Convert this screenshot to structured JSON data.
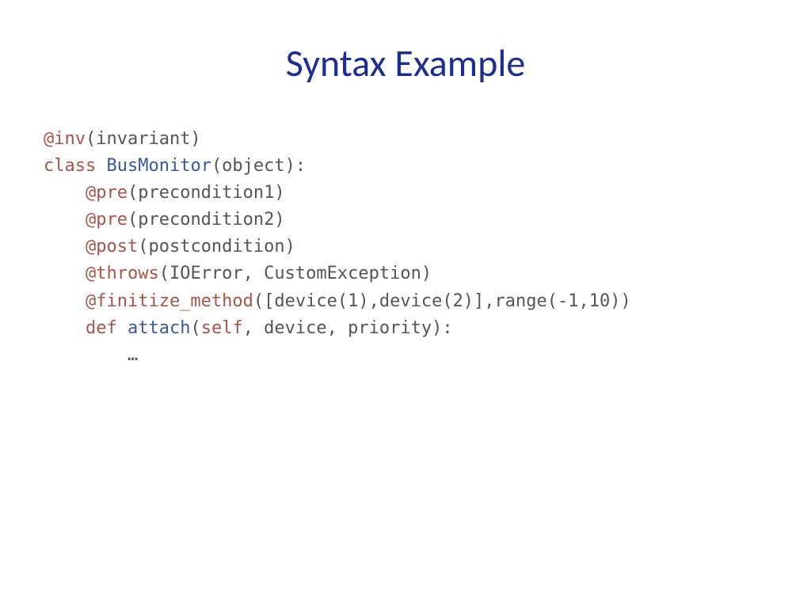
{
  "title": "Syntax Example",
  "code": {
    "line1": {
      "decorator": "@inv",
      "rest": "(invariant)"
    },
    "line2": {
      "keyword": "class ",
      "classname": "BusMonitor",
      "rest": "(object):"
    },
    "line3": {
      "indent": "    ",
      "decorator": "@pre",
      "rest": "(precondition1)"
    },
    "line4": {
      "indent": "    ",
      "decorator": "@pre",
      "rest": "(precondition2)"
    },
    "line5": {
      "indent": "    ",
      "decorator": "@post",
      "rest": "(postcondition)"
    },
    "line6": {
      "indent": "    ",
      "decorator": "@throws",
      "rest": "(IOError, CustomException)"
    },
    "line7": {
      "indent": "    ",
      "decorator": "@finitize_method",
      "rest": "([device(1),device(2)],range(-1,10))"
    },
    "line8": {
      "indent": "    ",
      "defkw": "def ",
      "funcname": "attach",
      "open": "(",
      "selfkw": "self",
      "rest": ", device, priority):"
    },
    "line9": {
      "indent": "        ",
      "rest": "…"
    }
  }
}
